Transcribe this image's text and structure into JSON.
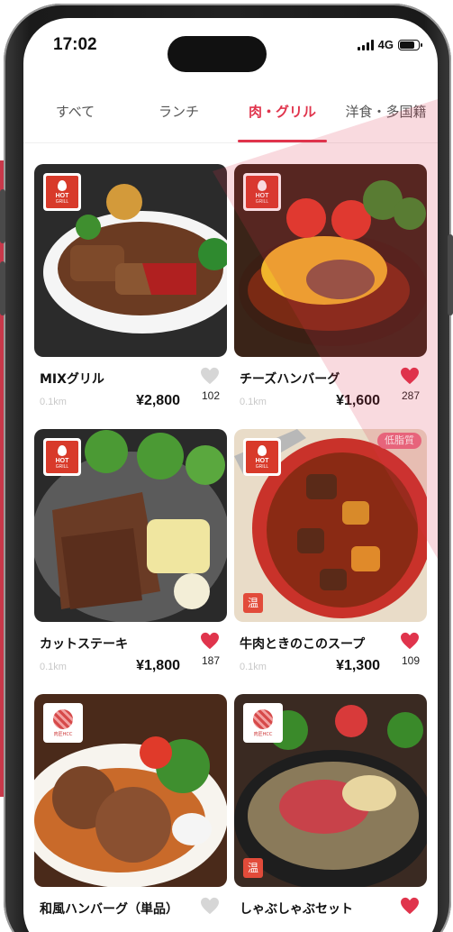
{
  "status_bar": {
    "time": "17:02",
    "network": "4G",
    "battery_level": 0.8
  },
  "tabs": [
    {
      "label": "すべて",
      "active": false
    },
    {
      "label": "ランチ",
      "active": false
    },
    {
      "label": "肉・グリル",
      "active": true
    },
    {
      "label": "洋食・多国籍",
      "active": false
    }
  ],
  "badges": {
    "hot_line1": "HOT",
    "hot_line2": "GRILL",
    "meat_label": "肉匠HCC",
    "warm": "温",
    "low_fat": "低脂質"
  },
  "colors": {
    "accent": "#e0344c",
    "heart_active": "#e0344c",
    "heart_inactive": "#d6d6d6"
  },
  "items": [
    {
      "name": "MIXグリル",
      "distance": "0.1km",
      "price": "¥2,800",
      "likes": "102",
      "liked": false,
      "badge": "hot",
      "icon": "steak-platter"
    },
    {
      "name": "チーズハンバーグ",
      "distance": "0.1km",
      "price": "¥1,600",
      "likes": "287",
      "liked": true,
      "badge": "hot",
      "icon": "cheese-hamburg"
    },
    {
      "name": "カットステーキ",
      "distance": "0.1km",
      "price": "¥1,800",
      "likes": "187",
      "liked": true,
      "badge": "hot",
      "icon": "cut-steak"
    },
    {
      "name": "牛肉ときのこのスープ",
      "distance": "0.1km",
      "price": "¥1,300",
      "likes": "109",
      "liked": true,
      "badge": "hot",
      "icon": "beef-stew",
      "low_fat": true,
      "warm": true
    },
    {
      "name": "和風ハンバーグ（単品）",
      "distance": "",
      "price": "",
      "likes": "",
      "liked": false,
      "badge": "meat",
      "icon": "japanese-hamburg"
    },
    {
      "name": "しゃぶしゃぶセット",
      "distance": "",
      "price": "",
      "likes": "",
      "liked": true,
      "badge": "meat",
      "icon": "shabu-shabu",
      "warm": true
    }
  ]
}
